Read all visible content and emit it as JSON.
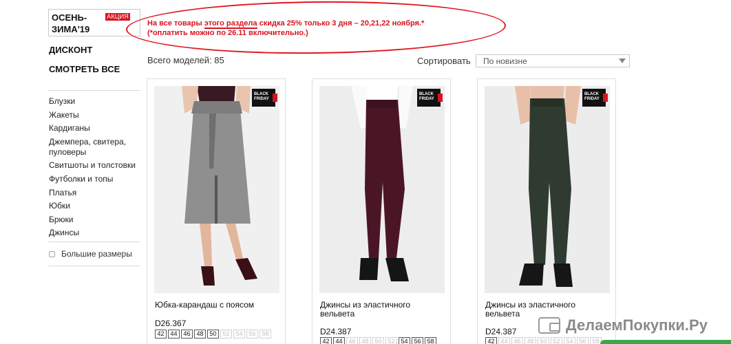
{
  "sidebar": {
    "season": "ОСЕНЬ-ЗИМА'19",
    "season_badge": "АКЦИЯ",
    "discount": "ДИСКОНТ",
    "see_all": "СМОТРЕТЬ ВСЕ",
    "categories": [
      "Блузки",
      "Жакеты",
      "Кардиганы",
      "Джемпера, свитера, пуловеры",
      "Свитшоты и толстовки",
      "Футболки и топы",
      "Платья",
      "Юбки",
      "Брюки",
      "Джинсы"
    ],
    "plus_sizes": "Большие размеры"
  },
  "promo": {
    "line1_pre": "На все товары ",
    "line1_highlight": "этого раздела",
    "line1_post": " скидка 25% только 3 дня – 20,21,22 ноября.*",
    "line2": "(*оплатить можно по 26.11 включительно.)"
  },
  "toolbar": {
    "total": "Всего моделей: 85",
    "sort_label": "Сортировать",
    "sort_value": "По новизне"
  },
  "badge": {
    "line1": "BLACK",
    "line2": "FRIDAY"
  },
  "products": [
    {
      "name": "Юбка-карандаш с поясом",
      "price": "D26.367",
      "sizes": [
        {
          "s": "42",
          "a": true
        },
        {
          "s": "44",
          "a": true
        },
        {
          "s": "46",
          "a": true
        },
        {
          "s": "48",
          "a": true
        },
        {
          "s": "50",
          "a": true
        },
        {
          "s": "52",
          "a": false
        },
        {
          "s": "54",
          "a": false
        },
        {
          "s": "56",
          "a": false
        },
        {
          "s": "58",
          "a": false
        }
      ]
    },
    {
      "name": "Джинсы из эластичного вельвета",
      "price": "D24.387",
      "sizes": [
        {
          "s": "42",
          "a": true
        },
        {
          "s": "44",
          "a": true
        },
        {
          "s": "46",
          "a": false
        },
        {
          "s": "48",
          "a": false
        },
        {
          "s": "50",
          "a": false
        },
        {
          "s": "52",
          "a": false
        },
        {
          "s": "54",
          "a": true
        },
        {
          "s": "56",
          "a": true
        },
        {
          "s": "58",
          "a": true
        }
      ]
    },
    {
      "name": "Джинсы из эластичного вельвета",
      "price": "D24.387",
      "sizes": [
        {
          "s": "42",
          "a": true
        },
        {
          "s": "44",
          "a": false
        },
        {
          "s": "46",
          "a": false
        },
        {
          "s": "48",
          "a": false
        },
        {
          "s": "50",
          "a": false
        },
        {
          "s": "52",
          "a": false
        },
        {
          "s": "54",
          "a": false
        },
        {
          "s": "56",
          "a": false
        },
        {
          "s": "58",
          "a": false
        }
      ]
    }
  ],
  "watermark": "ДелаемПокупки.Ру",
  "colors": {
    "accent": "#d7131f",
    "skirt": "#9a9a9a",
    "jeans_burgundy": "#4a1626",
    "jeans_green": "#2e3a2e"
  }
}
